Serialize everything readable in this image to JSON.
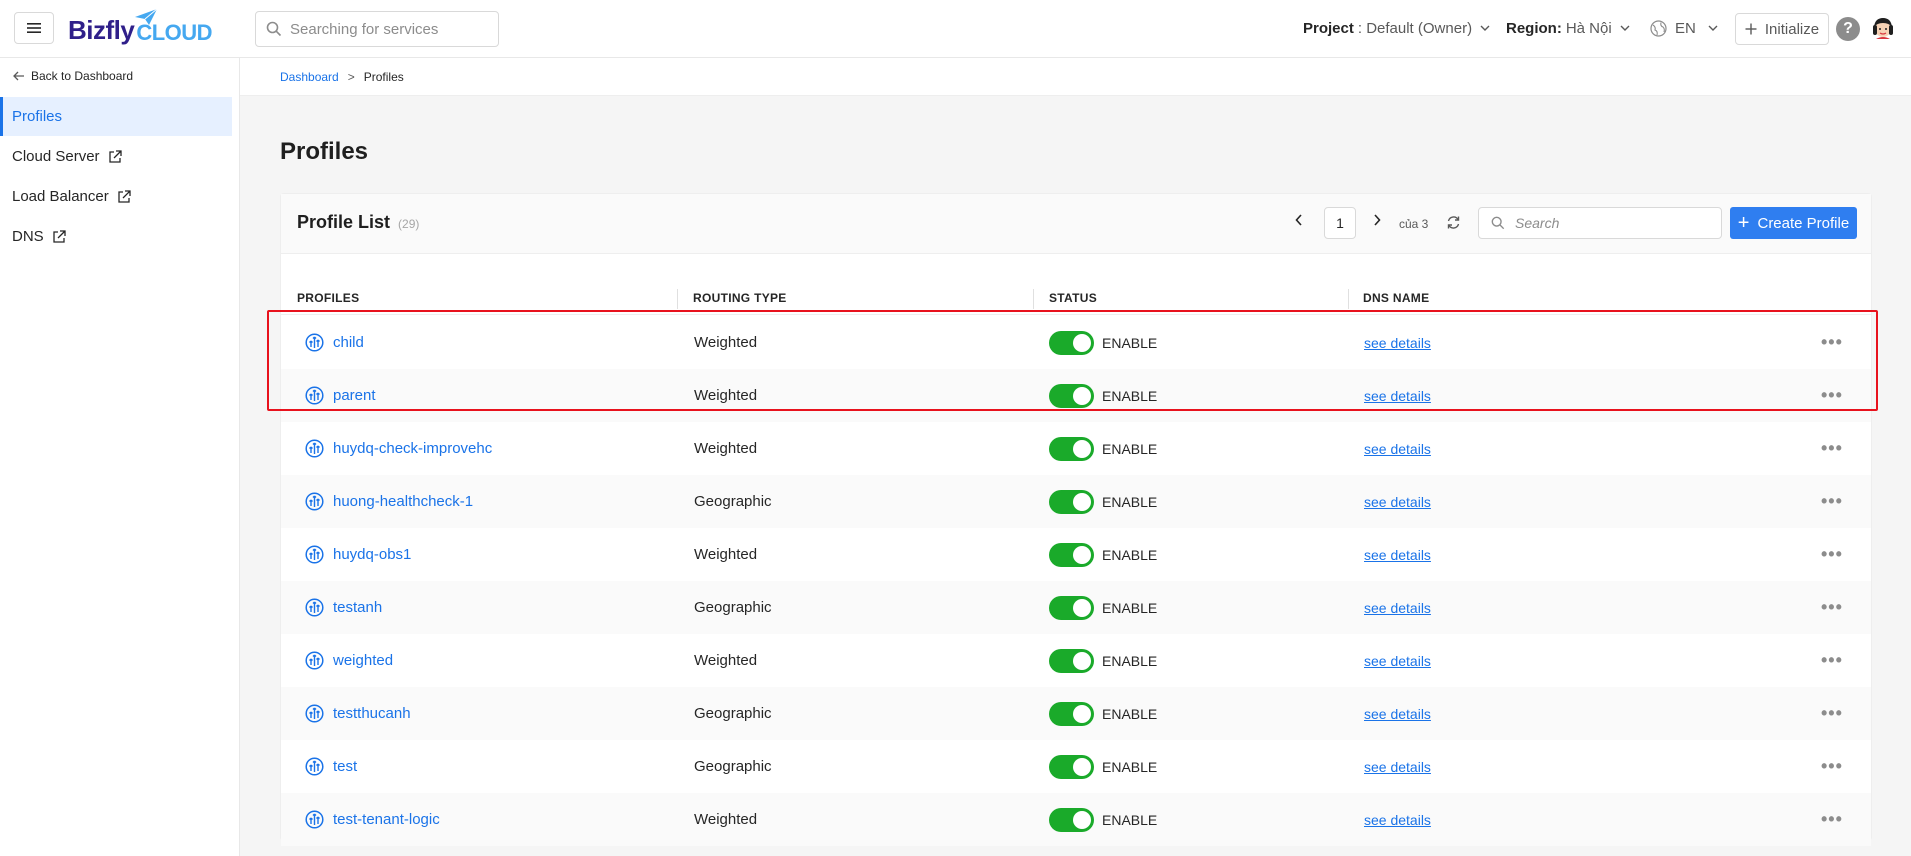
{
  "header": {
    "search_placeholder": "Searching for services",
    "project_label": "Project",
    "project_value": ": Default (Owner)",
    "region_label": "Region:",
    "region_value": "Hà Nội",
    "language": "EN",
    "initialize_label": "Initialize",
    "help_symbol": "?",
    "logo_primary": "Bizfly",
    "logo_secondary": "CLOUD"
  },
  "sidebar": {
    "back_label": "Back to Dashboard",
    "items": [
      {
        "label": "Profiles",
        "active": true,
        "external": false
      },
      {
        "label": "Cloud Server",
        "active": false,
        "external": true
      },
      {
        "label": "Load Balancer",
        "active": false,
        "external": true
      },
      {
        "label": "DNS",
        "active": false,
        "external": true
      }
    ]
  },
  "breadcrumb": {
    "parent": "Dashboard",
    "separator": ">",
    "current": "Profiles"
  },
  "page": {
    "title": "Profiles"
  },
  "profile_list": {
    "title": "Profile List",
    "count": "(29)",
    "current_page": "1",
    "of_pages": "của 3",
    "search_placeholder": "Search",
    "create_label": "Create Profile",
    "columns": [
      "PROFILES",
      "ROUTING TYPE",
      "STATUS",
      "DNS NAME"
    ],
    "rows": [
      {
        "name": "child",
        "routing": "Weighted",
        "status": "ENABLE",
        "dns": "see details",
        "highlighted": true
      },
      {
        "name": "parent",
        "routing": "Weighted",
        "status": "ENABLE",
        "dns": "see details",
        "highlighted": true
      },
      {
        "name": "huydq-check-improvehc",
        "routing": "Weighted",
        "status": "ENABLE",
        "dns": "see details"
      },
      {
        "name": "huong-healthcheck-1",
        "routing": "Geographic",
        "status": "ENABLE",
        "dns": "see details"
      },
      {
        "name": "huydq-obs1",
        "routing": "Weighted",
        "status": "ENABLE",
        "dns": "see details"
      },
      {
        "name": "testanh",
        "routing": "Geographic",
        "status": "ENABLE",
        "dns": "see details"
      },
      {
        "name": "weighted",
        "routing": "Weighted",
        "status": "ENABLE",
        "dns": "see details"
      },
      {
        "name": "testthucanh",
        "routing": "Geographic",
        "status": "ENABLE",
        "dns": "see details"
      },
      {
        "name": "test",
        "routing": "Geographic",
        "status": "ENABLE",
        "dns": "see details"
      },
      {
        "name": "test-tenant-logic",
        "routing": "Weighted",
        "status": "ENABLE",
        "dns": "see details"
      }
    ],
    "more_symbol": "•••"
  },
  "colors": {
    "accent": "#1a73e8",
    "primary_button": "#2f7ef0",
    "toggle_on": "#1aaa2a",
    "highlight_border": "#e8121d"
  },
  "icons": {
    "menu": "hamburger-icon",
    "search": "search-icon",
    "chevron": "chevron-down-icon",
    "globe": "globe-icon",
    "plus": "plus-icon",
    "help": "help-icon",
    "back": "arrow-left-icon",
    "external": "external-link-icon",
    "refresh": "refresh-icon",
    "profile": "traffic-profile-icon",
    "more": "more-horizontal-icon"
  }
}
